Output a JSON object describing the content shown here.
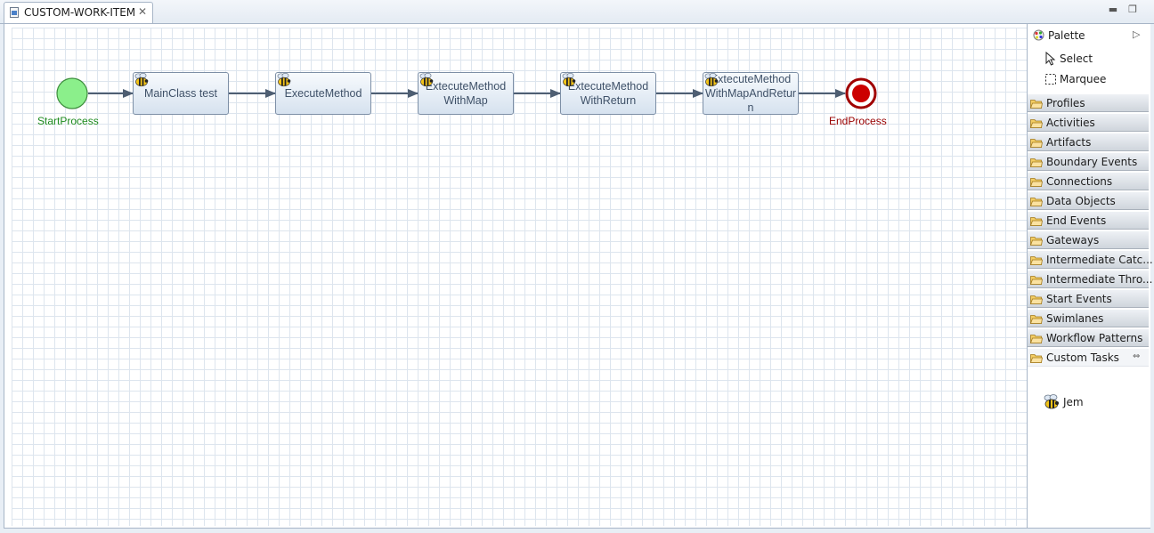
{
  "editor": {
    "tab_title": "CUSTOM-WORK-ITEM",
    "close_glyph": "✕",
    "minimize_glyph": "▬",
    "maximize_glyph": "❐"
  },
  "diagram": {
    "start_event": {
      "label": "StartProcess",
      "color": "#1c8a1c",
      "fill": "#8bef8b"
    },
    "end_event": {
      "label": "EndProcess",
      "color": "#990000",
      "fill": "#cc0000"
    },
    "tasks": [
      {
        "id": "t1",
        "lines": [
          "MainClass test"
        ]
      },
      {
        "id": "t2",
        "lines": [
          "ExecuteMethod"
        ]
      },
      {
        "id": "t3",
        "lines": [
          "ExtecuteMethod",
          "WithMap"
        ]
      },
      {
        "id": "t4",
        "lines": [
          "ExtecuteMethod",
          "WithReturn"
        ]
      },
      {
        "id": "t5",
        "lines": [
          "ExtecuteMethod",
          "WithMapAndRetur",
          "n"
        ]
      }
    ],
    "task_icon": "bee-icon"
  },
  "palette": {
    "title": "Palette",
    "collapse_glyph": "▷",
    "tools": [
      {
        "label": "Select",
        "icon": "pointer-icon"
      },
      {
        "label": "Marquee",
        "icon": "marquee-icon"
      }
    ],
    "drawers": [
      {
        "label": "Profiles",
        "open": false
      },
      {
        "label": "Activities",
        "open": false
      },
      {
        "label": "Artifacts",
        "open": false
      },
      {
        "label": "Boundary Events",
        "open": false
      },
      {
        "label": "Connections",
        "open": false
      },
      {
        "label": "Data Objects",
        "open": false
      },
      {
        "label": "End Events",
        "open": false
      },
      {
        "label": "Gateways",
        "open": false
      },
      {
        "label": "Intermediate Catc...",
        "open": false
      },
      {
        "label": "Intermediate Thro...",
        "open": false
      },
      {
        "label": "Start Events",
        "open": false
      },
      {
        "label": "Swimlanes",
        "open": false
      },
      {
        "label": "Workflow Patterns",
        "open": false
      },
      {
        "label": "Custom Tasks",
        "open": true
      }
    ],
    "pin_glyph": "⇔",
    "custom_tasks": [
      {
        "label": "Jem",
        "icon": "bee-icon"
      }
    ]
  }
}
